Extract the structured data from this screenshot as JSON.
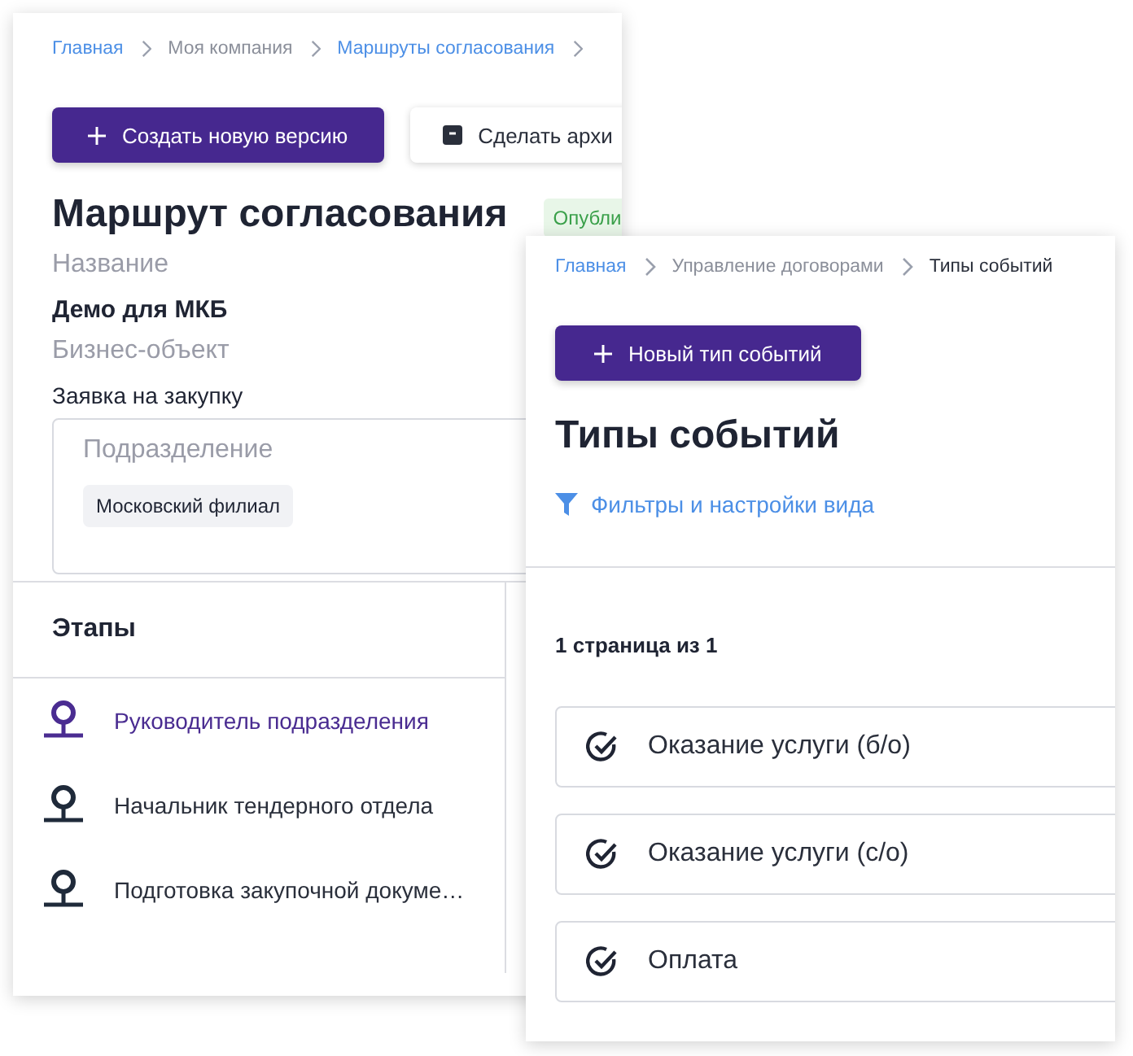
{
  "route_window": {
    "breadcrumbs": [
      {
        "label": "Главная",
        "link": true
      },
      {
        "label": "Моя компания",
        "link": false
      },
      {
        "label": "Маршруты согласования",
        "link": true
      }
    ],
    "buttons": [
      {
        "label": "Создать новую версию",
        "kind": "primary"
      },
      {
        "label": "Сделать архи",
        "kind": "secondary"
      }
    ],
    "title": "Маршрут согласования",
    "status": "Опубли",
    "fields": [
      {
        "label": "Название",
        "value": "Демо для МКБ",
        "bold": true
      },
      {
        "label": "Бизнес-объект",
        "value": "Заявка на закупку",
        "bold": false
      }
    ],
    "department": {
      "label": "Подразделение",
      "chips": [
        "Московский филиал"
      ]
    },
    "stages_title": "Этапы",
    "stages": [
      {
        "label": "Руководитель подразделения",
        "selected": true
      },
      {
        "label": "Начальник тендерного отдела",
        "selected": false
      },
      {
        "label": "Подготовка закупочной докуме…",
        "selected": false
      }
    ]
  },
  "events_window": {
    "breadcrumbs": [
      {
        "label": "Главная",
        "link": true
      },
      {
        "label": "Управление договорами",
        "link": false
      },
      {
        "label": "Типы событий",
        "link": false,
        "current": true
      }
    ],
    "button": "Новый тип событий",
    "title": "Типы событий",
    "filter_link": "Фильтры и настройки вида",
    "pagination": "1 страница из 1",
    "items": [
      {
        "label": "Оказание услуги (б/о)"
      },
      {
        "label": "Оказание услуги (с/о)"
      },
      {
        "label": "Оплата"
      }
    ]
  }
}
